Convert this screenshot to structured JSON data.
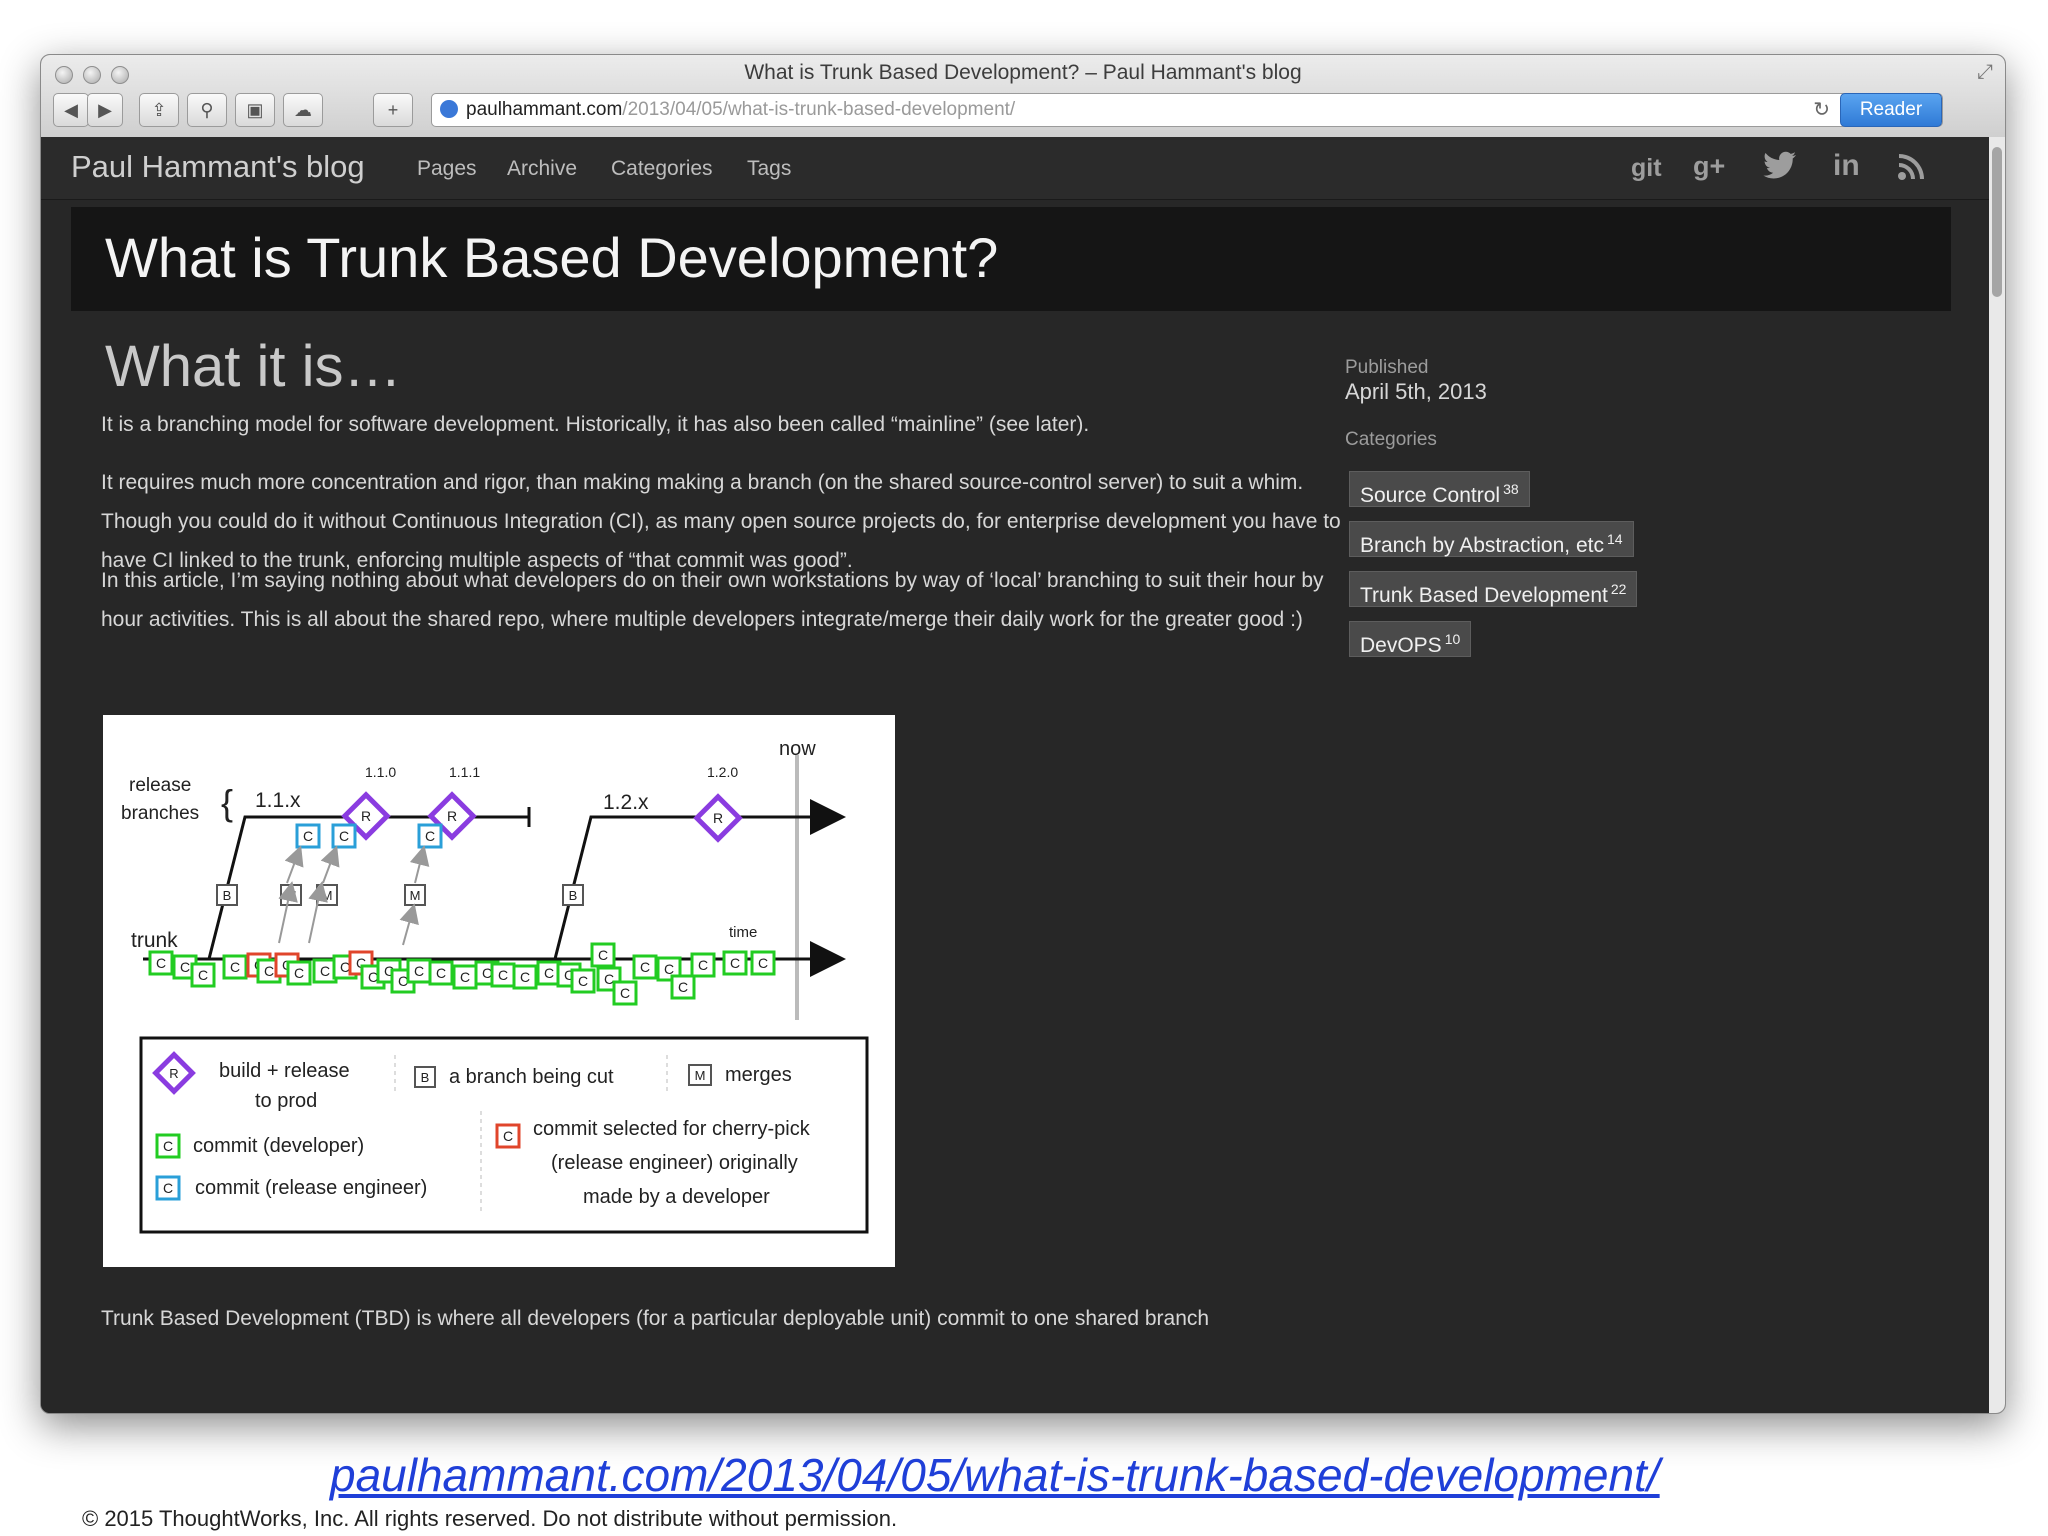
{
  "window": {
    "title": "What is Trunk Based Development? – Paul Hammant's blog",
    "url_host": "paulhammant.com",
    "url_path": "/2013/04/05/what-is-trunk-based-development/",
    "reader_label": "Reader"
  },
  "nav": {
    "brand": "Paul Hammant's blog",
    "links": [
      "Pages",
      "Archive",
      "Categories",
      "Tags"
    ],
    "social": [
      "git",
      "g+",
      "twitter",
      "in",
      "rss"
    ]
  },
  "article": {
    "title": "What is Trunk Based Development?",
    "section_heading": "What it is…",
    "paragraphs": [
      "It is a branching model for software development. Historically, it has also been called “mainline” (see later).",
      "It requires much more concentration and rigor, than making making a branch (on the shared source-control server) to suit a whim. Though you could do it without Continuous Integration (CI), as many open source projects do, for enterprise development you have to have CI linked to the trunk, enforcing multiple aspects of “that commit was good”.",
      "In this article, I’m saying nothing about what developers do on their own workstations by way of ‘local’ branching to suit their hour by hour activities. This is all about the shared repo, where multiple developers integrate/merge their daily work for the greater good :)",
      "Trunk Based Development (TBD) is where all developers (for a particular deployable unit) commit to one shared branch"
    ]
  },
  "sidebar": {
    "published_label": "Published",
    "published_date": "April 5th, 2013",
    "categories_label": "Categories",
    "categories": [
      {
        "name": "Source Control",
        "count": "38"
      },
      {
        "name": "Branch by Abstraction, etc",
        "count": "14"
      },
      {
        "name": "Trunk Based Development",
        "count": "22"
      },
      {
        "name": "DevOPS",
        "count": "10"
      }
    ]
  },
  "diagram": {
    "now": "now",
    "time": "time",
    "trunk": "trunk",
    "release": "release",
    "branches": "branches",
    "branch_1": "1.1.x",
    "branch_2": "1.2.x",
    "v110": "1.1.0",
    "v111": "1.1.1",
    "v120": "1.2.0",
    "legend": {
      "build_release_1": "build + release",
      "build_release_2": "to prod",
      "branch_cut": "a branch being cut",
      "merges": "merges",
      "commit_dev": "commit (developer)",
      "commit_rel": "commit (release engineer)",
      "cherry_1": "commit selected for cherry-pick",
      "cherry_2": "(release engineer) originally",
      "cherry_3": "made by a developer"
    },
    "colors": {
      "green": "#22cc22",
      "blue": "#2a9fd8",
      "red": "#e0452b",
      "purple": "#8a3ce0"
    }
  },
  "footer": {
    "url": "paulhammant.com/2013/04/05/what-is-trunk-based-development/",
    "copyright": "© 2015 ThoughtWorks, Inc. All rights reserved. Do not distribute without permission."
  }
}
